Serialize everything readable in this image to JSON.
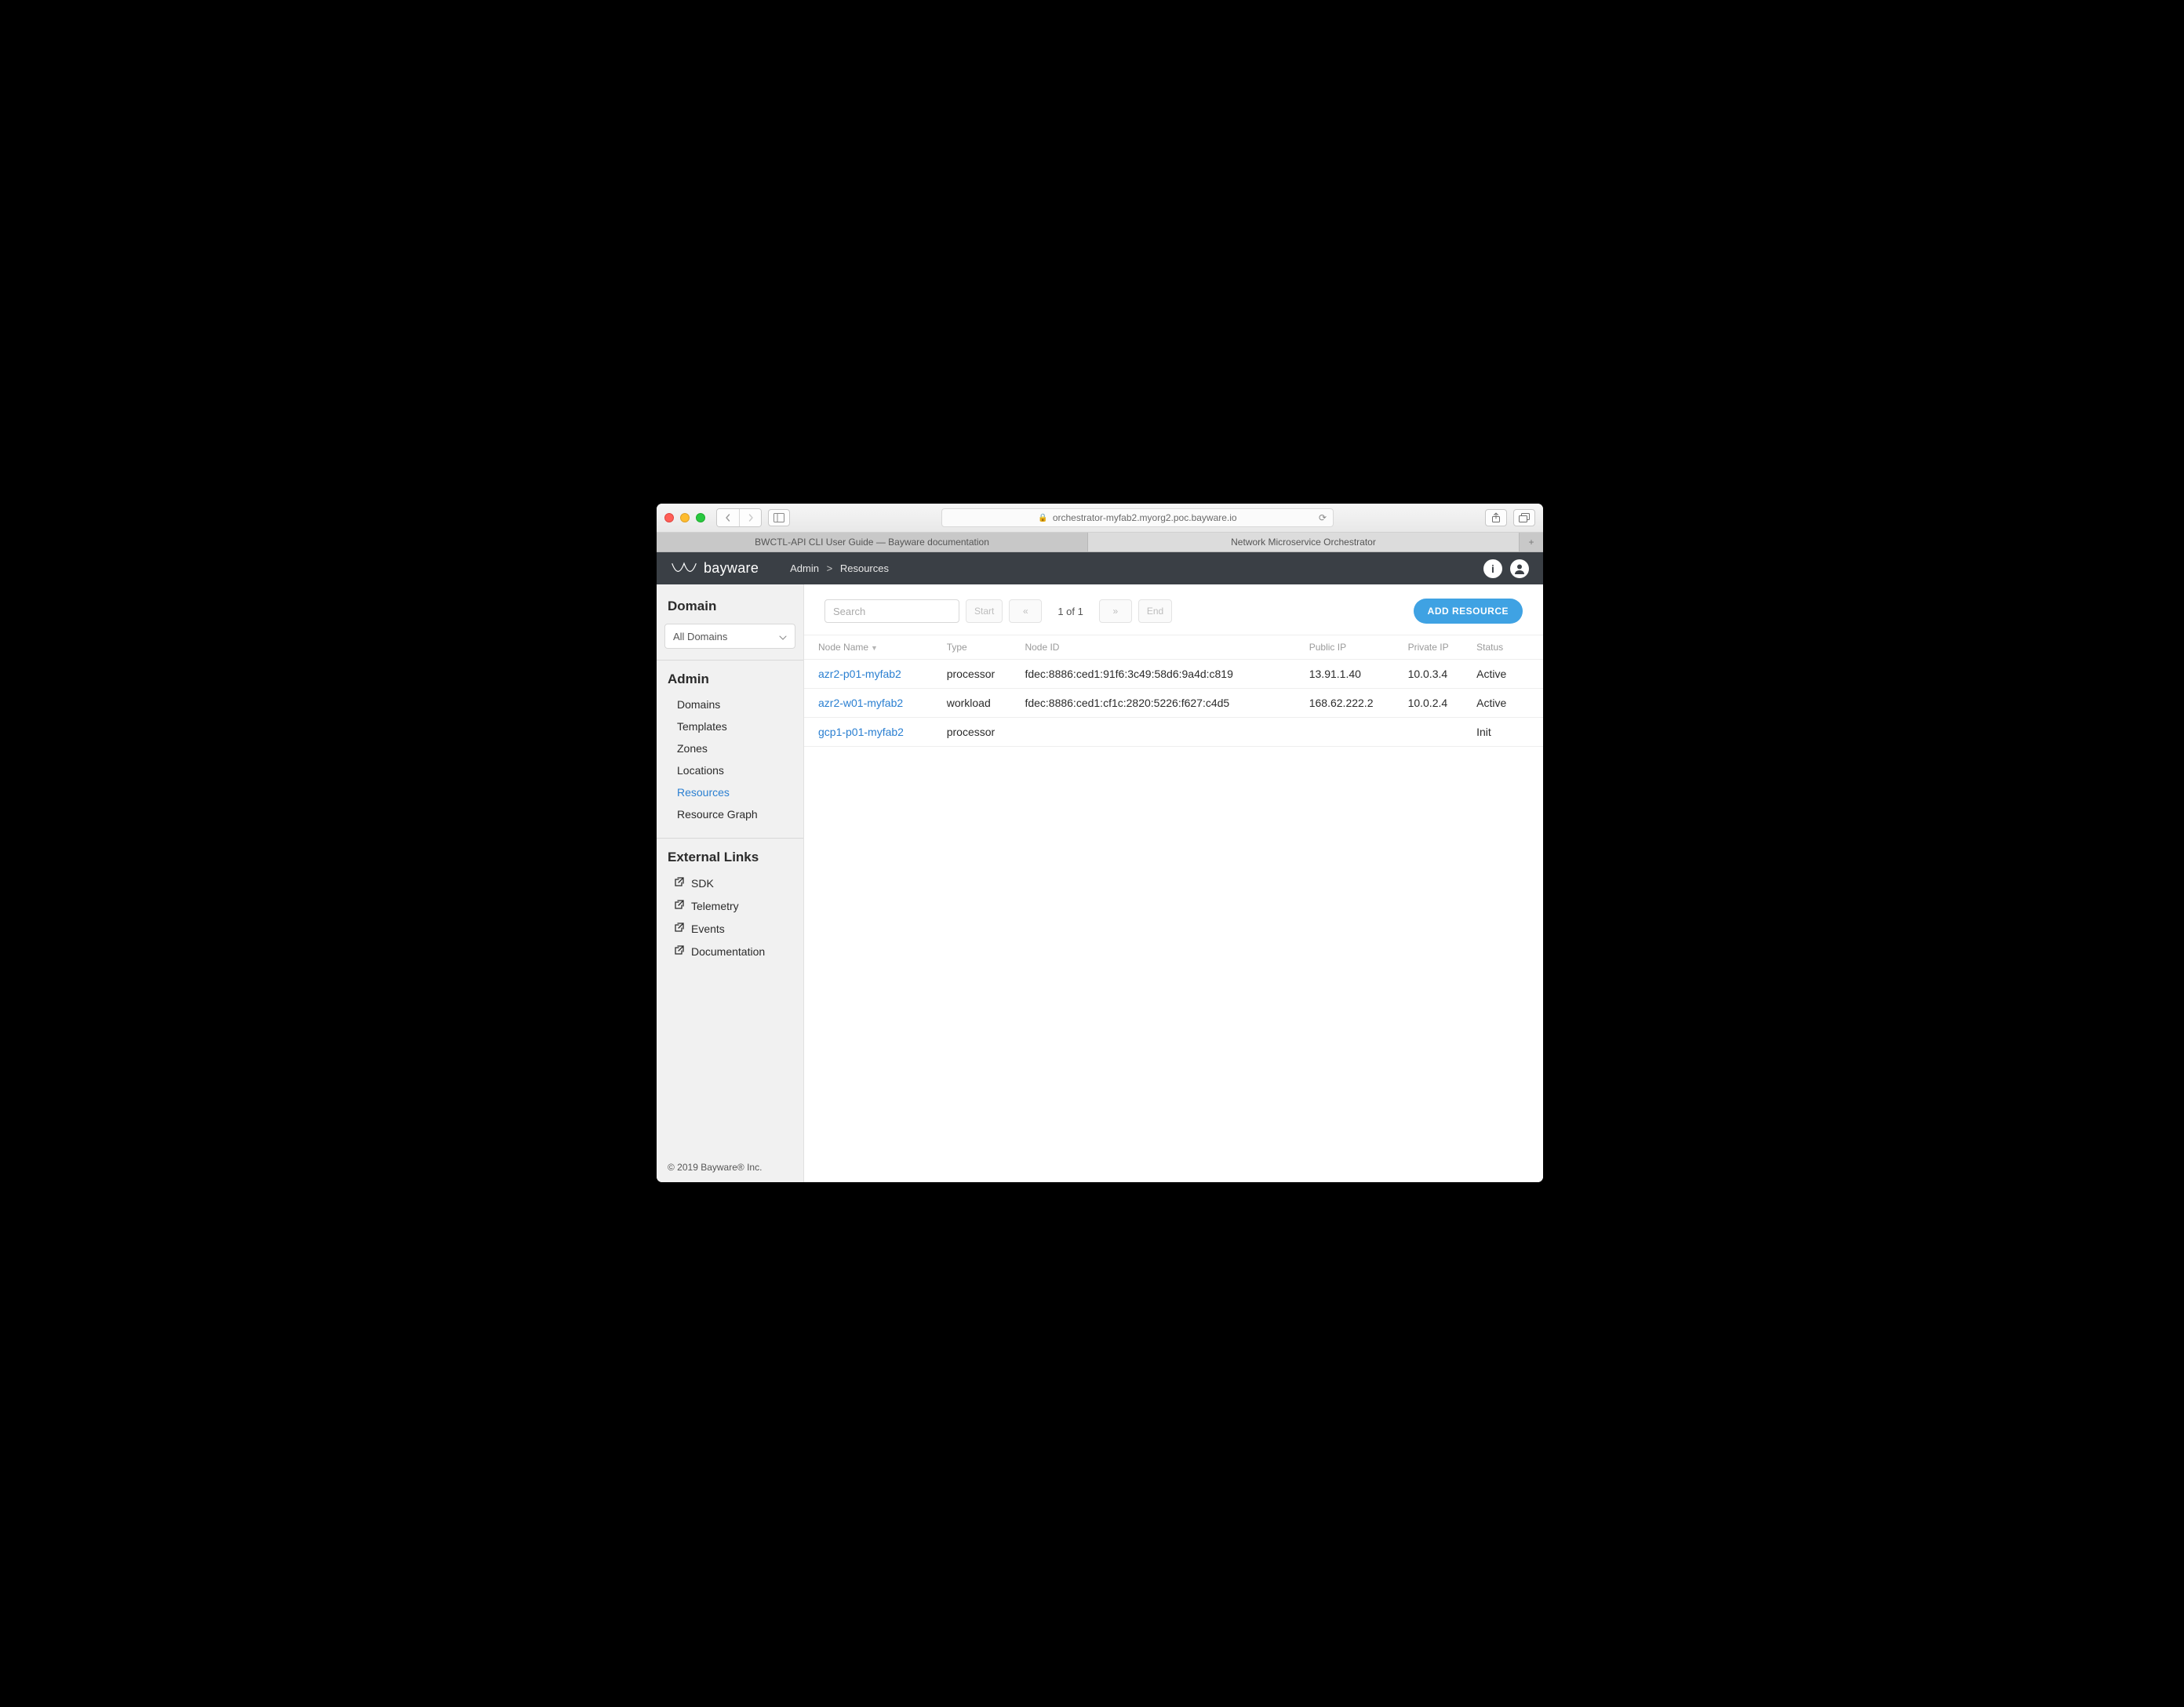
{
  "browser": {
    "url_host": "orchestrator-myfab2.myorg2.poc.bayware.io",
    "tabs": [
      "BWCTL-API CLI User Guide — Bayware documentation",
      "Network Microservice Orchestrator"
    ],
    "active_tab_index": 1
  },
  "header": {
    "brand": "bayware",
    "breadcrumb": [
      "Admin",
      "Resources"
    ]
  },
  "sidebar": {
    "domain_title": "Domain",
    "domain_select": "All Domains",
    "admin_title": "Admin",
    "admin_items": [
      "Domains",
      "Templates",
      "Zones",
      "Locations",
      "Resources",
      "Resource Graph"
    ],
    "admin_active_index": 4,
    "external_title": "External Links",
    "external_items": [
      "SDK",
      "Telemetry",
      "Events",
      "Documentation"
    ],
    "footer": "© 2019 Bayware® Inc."
  },
  "toolbar": {
    "search_placeholder": "Search",
    "pager_start": "Start",
    "pager_prev": "«",
    "pager_info": "1 of 1",
    "pager_next": "»",
    "pager_end": "End",
    "add_button": "ADD RESOURCE"
  },
  "table": {
    "columns": [
      "Node Name",
      "Type",
      "Node ID",
      "Public IP",
      "Private IP",
      "Status"
    ],
    "rows": [
      {
        "name": "azr2-p01-myfab2",
        "type": "processor",
        "node_id": "fdec:8886:ced1:91f6:3c49:58d6:9a4d:c819",
        "public_ip": "13.91.1.40",
        "private_ip": "10.0.3.4",
        "status": "Active"
      },
      {
        "name": "azr2-w01-myfab2",
        "type": "workload",
        "node_id": "fdec:8886:ced1:cf1c:2820:5226:f627:c4d5",
        "public_ip": "168.62.222.2",
        "private_ip": "10.0.2.4",
        "status": "Active"
      },
      {
        "name": "gcp1-p01-myfab2",
        "type": "processor",
        "node_id": "",
        "public_ip": "",
        "private_ip": "",
        "status": "Init"
      }
    ]
  }
}
